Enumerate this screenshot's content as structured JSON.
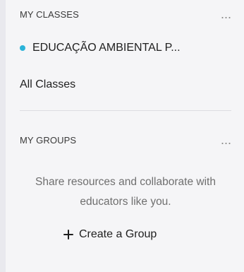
{
  "my_classes": {
    "title": "MY CLASSES",
    "more_label": "...",
    "class_item": {
      "name": "EDUCAÇÃO AMBIENTAL P...",
      "dot_color": "#2bb3d9"
    },
    "all_classes_label": "All Classes"
  },
  "my_groups": {
    "title": "MY GROUPS",
    "more_label": "...",
    "description": "Share resources and collaborate with educators like you.",
    "create_group_label": "Create a Group",
    "create_group_icon": "plus-icon"
  }
}
